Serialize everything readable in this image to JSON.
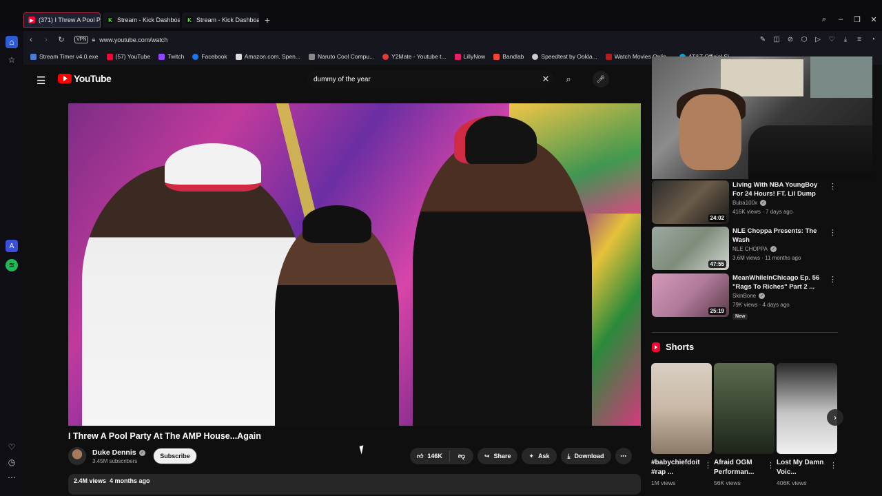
{
  "browser": {
    "tabs": [
      {
        "label": "(371) I Threw A Pool P",
        "icon": "youtube",
        "active": true
      },
      {
        "label": "Stream - Kick Dashboard",
        "icon": "kick",
        "active": false
      },
      {
        "label": "Stream - Kick Dashboard",
        "icon": "kick",
        "active": false
      }
    ],
    "new_tab": "+",
    "vpn_label": "VPN",
    "url": "www.youtube.com/watch",
    "bookmarks": [
      {
        "label": "Stream Timer v4.0.exe",
        "color": "#4a7bd1"
      },
      {
        "label": "(57) YouTube",
        "color": "#ff0033"
      },
      {
        "label": "Twitch",
        "color": "#9146ff"
      },
      {
        "label": "Facebook",
        "color": "#1877f2"
      },
      {
        "label": "Amazon.com. Spen...",
        "color": "#dddddd"
      },
      {
        "label": "Naruto Cool Compu...",
        "color": "#888888"
      },
      {
        "label": "Y2Mate - Youtube t...",
        "color": "#e53935"
      },
      {
        "label": "LillyNow",
        "color": "#e91e63"
      },
      {
        "label": "Bandlab",
        "color": "#f44336"
      },
      {
        "label": "Speedtest by Ookla...",
        "color": "#cccccc"
      },
      {
        "label": "Watch Movies Onlin...",
        "color": "#b71c1c"
      },
      {
        "label": "AT&T Official Si...",
        "color": "#00a8e0"
      }
    ]
  },
  "youtube": {
    "logo_text": "YouTube",
    "search_query": "dummy of the year",
    "video": {
      "title": "I Threw A Pool Party At The AMP House...Again",
      "channel": "Duke Dennis",
      "subscribers": "3.45M subscribers",
      "subscribe_label": "Subscribe",
      "likes": "146K",
      "share_label": "Share",
      "ask_label": "Ask",
      "download_label": "Download",
      "views": "2.4M views",
      "age": "4 months ago"
    },
    "recommendations": [
      {
        "title": "Living With NBA YoungBoy For 24 Hours! FT. Lil Dump",
        "channel": "Buba100x",
        "verified": true,
        "meta": "416K views · 7 days ago",
        "duration": "24:02",
        "new": false,
        "thumb_color": "#6a5a48"
      },
      {
        "title": "NLE Choppa Presents: The Wash",
        "channel": "NLE CHOPPA",
        "verified": true,
        "meta": "3.6M views · 11 months ago",
        "duration": "47:55",
        "new": false,
        "thumb_color": "#7f8c7a"
      },
      {
        "title": "MeanWhileInChicago Ep. 56 \"Rags To Riches\" Part 2 ...",
        "channel": "SkinBone",
        "verified": true,
        "meta": "79K views · 4 days ago",
        "duration": "25:19",
        "new": true,
        "new_label": "New",
        "thumb_color": "#b07a9a"
      }
    ],
    "shorts": {
      "heading": "Shorts",
      "items": [
        {
          "title": "#babychiefdoit #rap ...",
          "views": "1M views",
          "thumb_color": "#c9b8a6"
        },
        {
          "title": "Afraid OGM Performan...",
          "views": "56K views",
          "thumb_color": "#3b4a34"
        },
        {
          "title": "Lost My Damn Voic...",
          "views": "406K views",
          "thumb_color": "#c5c5c5"
        }
      ]
    }
  },
  "colors": {
    "youtube_red": "#ff0000",
    "kick_green": "#53fc18",
    "opera_red": "#ff1b2d"
  }
}
